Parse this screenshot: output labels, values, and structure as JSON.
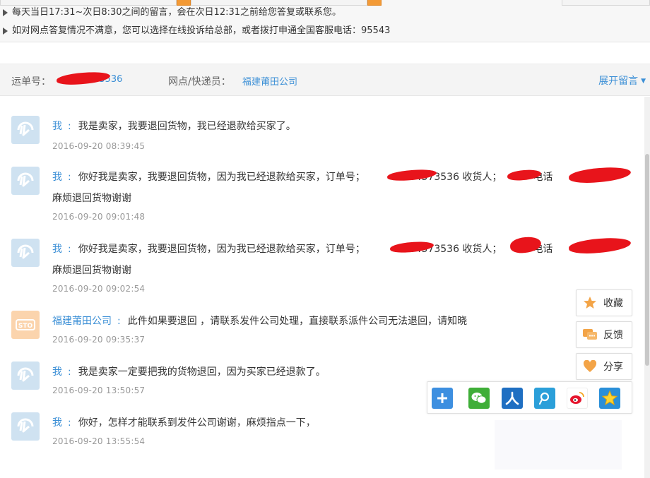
{
  "notice": {
    "line1": "每天当日17:31~次日8:30之间的留言，会在次日12:31之前给您答复或联系您。",
    "line2": "如对网点答复情况不满意，您可以选择在线投诉给总部，或者拨打申通全国客服电话：95543"
  },
  "waybill": {
    "label": "运单号：",
    "number_visible": "3536",
    "number_partial": "73536",
    "branch_label": "网点/快递员：",
    "branch_value": "福建莆田公司",
    "expand_label": "展开留言"
  },
  "messages": [
    {
      "author": "我",
      "avatar": "sto-logo-blue",
      "content": "我是卖家，我要退回货物，我已经退款给买家了。",
      "time": "2016-09-20 08:39:45"
    },
    {
      "author": "我",
      "avatar": "sto-logo-blue",
      "content_a": "你好我是卖家，我要退回货物，因为我已经退款给买家，订单号；",
      "content_b": "84573536 收货人；",
      "content_c": "电话",
      "content_line2": "麻烦退回货物谢谢",
      "time": "2016-09-20 09:01:48"
    },
    {
      "author": "我",
      "avatar": "sto-logo-blue",
      "content_a": "你好我是卖家，我要退回货物，因为我已经退款给买家，订单号；",
      "content_b": "84573536 收货人；",
      "content_c": "电话",
      "content_line2": "麻烦退回货物谢谢",
      "time": "2016-09-20 09:02:54"
    },
    {
      "author": "福建莆田公司",
      "avatar": "sto-logo-orange",
      "content": "此件如果要退回 ，请联系发件公司处理，直接联系派件公司无法退回，请知晓",
      "time": "2016-09-20 09:35:37"
    },
    {
      "author": "我",
      "avatar": "sto-logo-blue",
      "content": "我是卖家一定要把我的货物退回，因为买家已经退款了。",
      "time": "2016-09-20 13:50:57"
    },
    {
      "author": "我",
      "avatar": "sto-logo-blue",
      "content": "你好，怎样才能联系到发件公司谢谢，麻烦指点一下，",
      "time": "2016-09-20 13:55:54"
    }
  ],
  "side": {
    "favorite_label": "收藏",
    "feedback_label": "反馈",
    "share_label": "分享"
  },
  "share_icons": [
    "plus-icon",
    "wechat-icon",
    "renren-icon",
    "tencent-weibo-icon",
    "sina-weibo-icon",
    "qzone-icon"
  ],
  "colors": {
    "accent_blue": "#3b8fd6",
    "sto_orange": "#f39a36",
    "redaction": "#e8141b"
  }
}
